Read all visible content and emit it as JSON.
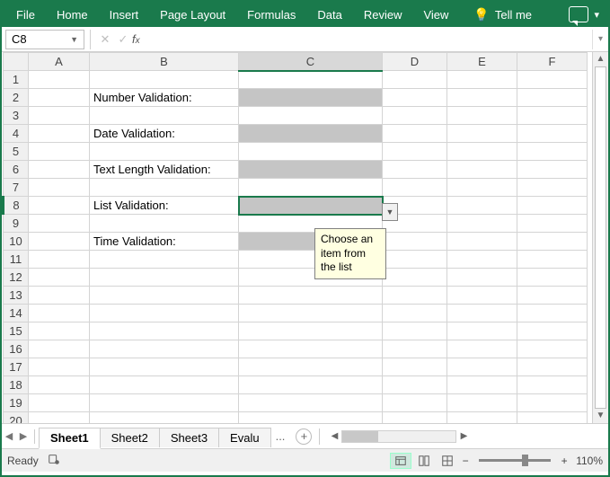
{
  "ribbon": {
    "tabs": [
      "File",
      "Home",
      "Insert",
      "Page Layout",
      "Formulas",
      "Data",
      "Review",
      "View"
    ],
    "tell_me": "Tell me"
  },
  "formula_bar": {
    "name_box": "C8",
    "formula": ""
  },
  "columns": [
    "A",
    "B",
    "C",
    "D",
    "E",
    "F"
  ],
  "rows": [
    "1",
    "2",
    "3",
    "4",
    "5",
    "6",
    "7",
    "8",
    "9",
    "10",
    "11",
    "12",
    "13",
    "14",
    "15",
    "16",
    "17",
    "18",
    "19",
    "20"
  ],
  "labels": {
    "r2": "Number Validation:",
    "r4": "Date Validation:",
    "r6": "Text Length Validation:",
    "r8": "List Validation:",
    "r10": "Time Validation:"
  },
  "selected_cell": "C8",
  "tooltip": "Choose an item from the list",
  "sheets": {
    "tabs": [
      "Sheet1",
      "Sheet2",
      "Sheet3",
      "Evalu"
    ],
    "active": "Sheet1",
    "more": "..."
  },
  "status": {
    "ready": "Ready",
    "zoom": "110%"
  }
}
